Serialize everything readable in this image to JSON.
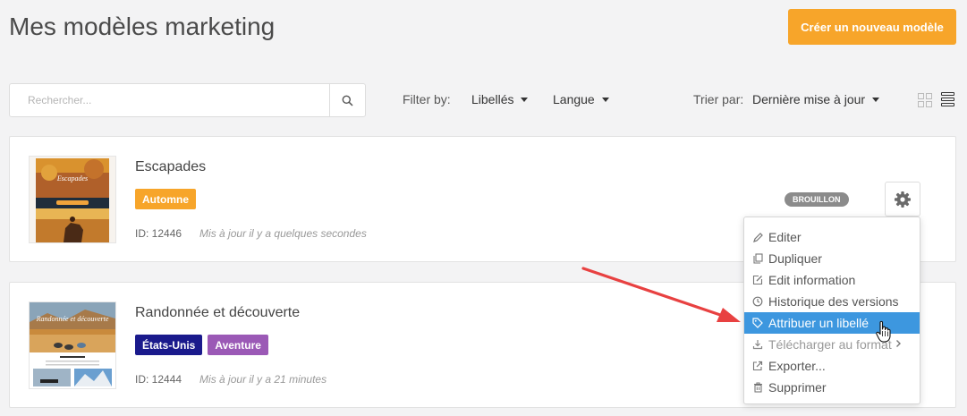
{
  "page": {
    "title": "Mes modèles marketing",
    "create_button": "Créer un nouveau modèle"
  },
  "search": {
    "placeholder": "Rechercher...",
    "value": ""
  },
  "filters": {
    "filter_by_label": "Filter by:",
    "labels_dropdown": "Libellés",
    "language_dropdown": "Langue",
    "sort_label": "Trier par:",
    "sort_value": "Dernière mise à jour"
  },
  "templates": [
    {
      "name": "Escapades",
      "tags": [
        {
          "label": "Automne",
          "color": "#f7a52a"
        }
      ],
      "id_text": "ID: 12446",
      "updated": "Mis à jour il y a quelques secondes",
      "status": "BROUILLON",
      "thumbnail_title": "Escapades"
    },
    {
      "name": "Randonnée et découverte",
      "tags": [
        {
          "label": "États-Unis",
          "color": "#1a1a8c"
        },
        {
          "label": "Aventure",
          "color": "#9b59b6"
        }
      ],
      "id_text": "ID: 12444",
      "updated": "Mis à jour il y a 21 minutes",
      "thumbnail_title": "Randonnée et découverte"
    }
  ],
  "context_menu": {
    "items": [
      {
        "label": "Editer",
        "icon": "pencil-icon"
      },
      {
        "label": "Dupliquer",
        "icon": "copy-icon"
      },
      {
        "label": "Edit information",
        "icon": "edit-square-icon"
      },
      {
        "label": "Historique des versions",
        "icon": "clock-icon"
      },
      {
        "label": "Attribuer un libellé",
        "icon": "tag-icon",
        "state": "hover"
      },
      {
        "label": "Télécharger au format",
        "icon": "download-icon",
        "has_submenu": true
      },
      {
        "label": "Exporter...",
        "icon": "export-icon"
      },
      {
        "label": "Supprimer",
        "icon": "trash-icon"
      }
    ]
  },
  "colors": {
    "accent": "#f7a52a",
    "menu_highlight": "#3d97df",
    "annotation_arrow": "#e84141"
  }
}
